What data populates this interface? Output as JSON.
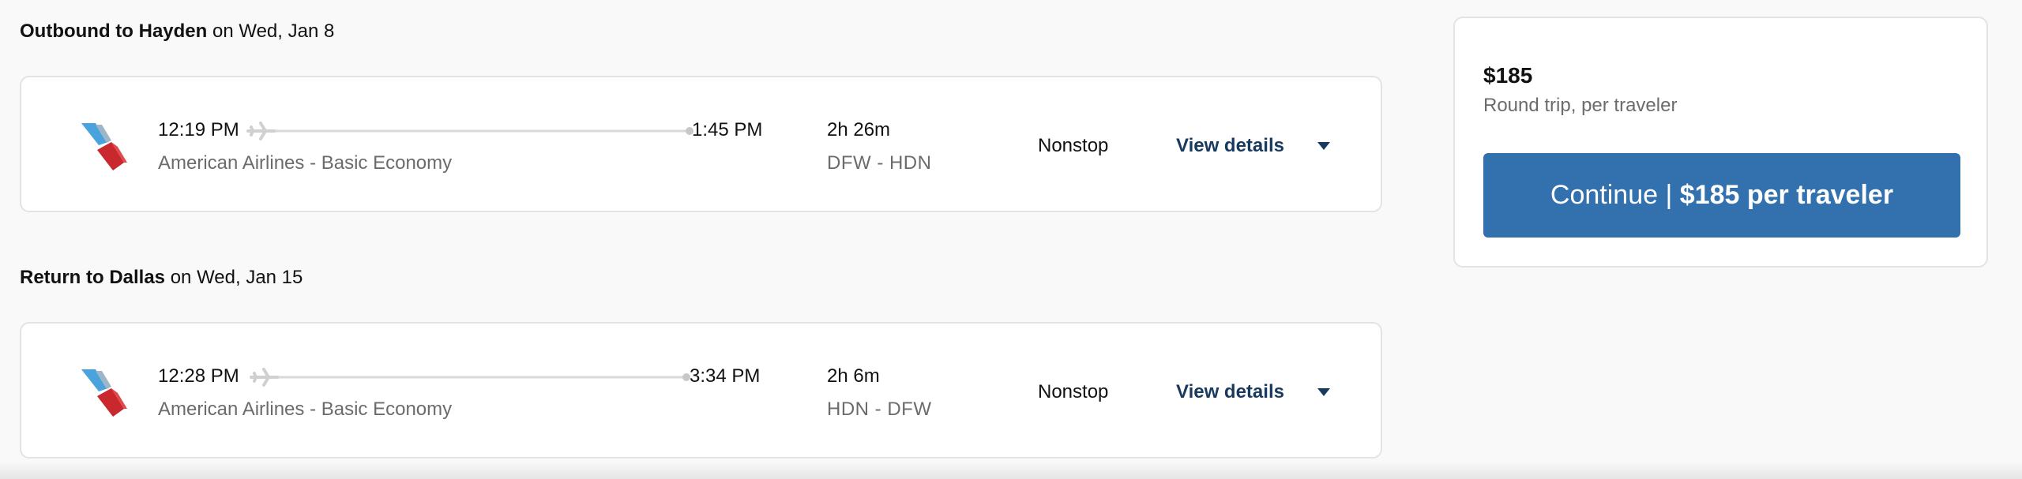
{
  "outbound": {
    "heading_bold": "Outbound to Hayden",
    "heading_rest": " on Wed, Jan 8",
    "depart_time": "12:19 PM",
    "arrive_time": "1:45 PM",
    "airline": "American Airlines - Basic Economy",
    "duration": "2h 26m",
    "airports": "DFW - HDN",
    "stops": "Nonstop",
    "view_details_label": "View details"
  },
  "return": {
    "heading_bold": "Return to Dallas",
    "heading_rest": " on Wed, Jan 15",
    "depart_time": "12:28 PM",
    "arrive_time": "3:34 PM",
    "airline": "American Airlines - Basic Economy",
    "duration": "2h 6m",
    "airports": "HDN - DFW",
    "stops": "Nonstop",
    "view_details_label": "View details"
  },
  "summary": {
    "price": "$185",
    "subtitle": "Round trip, per traveler",
    "button_prefix": "Continue | ",
    "button_price": "$185 per traveler"
  },
  "icons": {
    "airline_logo": "american-airlines-logo",
    "plane": "plane-icon",
    "caret": "chevron-down-icon"
  },
  "colors": {
    "button_bg": "#3271ad",
    "link": "#173a5e",
    "logo_blue": "#4aa3dd",
    "logo_red": "#c8282e"
  }
}
